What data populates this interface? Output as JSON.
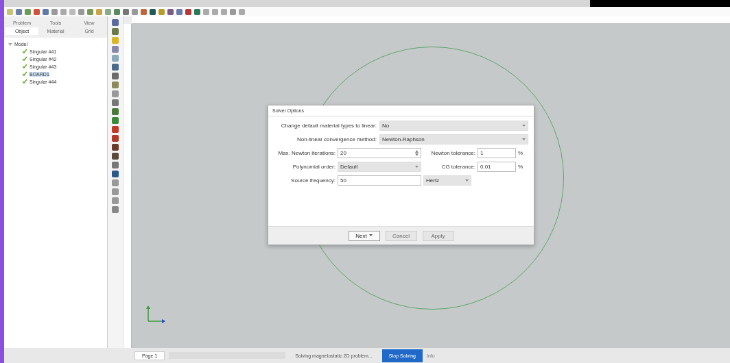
{
  "panel_tabs": [
    {
      "label": "Problem",
      "selected": false
    },
    {
      "label": "Tools",
      "selected": false
    },
    {
      "label": "View",
      "selected": false
    },
    {
      "label": "Object",
      "selected": true
    },
    {
      "label": "Material",
      "selected": false
    },
    {
      "label": "Grid",
      "selected": false
    }
  ],
  "tree": {
    "label": "Model",
    "expanded": true,
    "children": [
      {
        "label": "Singular #41",
        "checked": true,
        "selected": false
      },
      {
        "label": "Singular #42",
        "checked": true,
        "selected": false
      },
      {
        "label": "Singular #43",
        "checked": true,
        "selected": false
      },
      {
        "label": "BOARD1",
        "checked": true,
        "selected": true
      },
      {
        "label": "Singular #44",
        "checked": true,
        "selected": false
      }
    ]
  },
  "dialog": {
    "title": "Solver Options",
    "rows": [
      {
        "kind": "select",
        "label": "Change default material types to linear:",
        "value": "No"
      },
      {
        "kind": "select",
        "label": "Non-linear convergence method:",
        "value": "Newton-Raphson"
      }
    ],
    "pairs": [
      {
        "left": {
          "kind": "spin",
          "label": "Max. Newton iterations:",
          "value": "20"
        },
        "right": {
          "label": "Newton tolerance:",
          "value": "1",
          "unit": "%"
        }
      },
      {
        "left": {
          "kind": "select",
          "label": "Polynomial order:",
          "value": "Default"
        },
        "right": {
          "label": "CG tolerance:",
          "value": "0.01",
          "unit": "%"
        }
      }
    ],
    "frequency": {
      "label": "Source frequency:",
      "value": "50",
      "unit": "Hertz"
    },
    "buttons": [
      {
        "label": "Next",
        "dropdown": true,
        "disabled": false
      },
      {
        "label": "Cancel",
        "dropdown": false,
        "disabled": true
      },
      {
        "label": "Apply",
        "dropdown": false,
        "disabled": true
      }
    ]
  },
  "status_bar": {
    "page": "Page 1",
    "message": "Solving magnetostatic 2D problem...",
    "action": "Stop Solving",
    "extra": "Info"
  }
}
